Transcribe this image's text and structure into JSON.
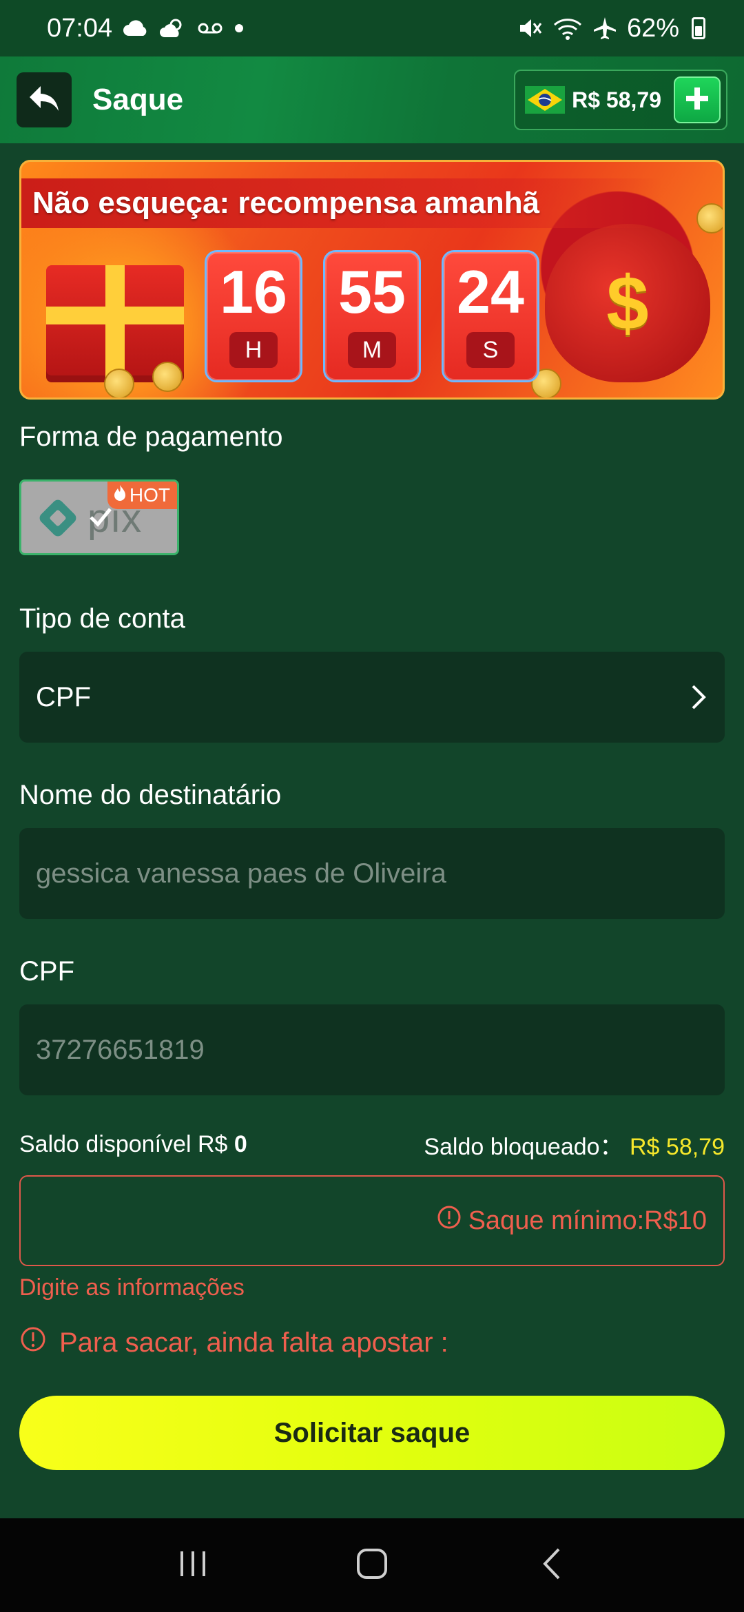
{
  "status_bar": {
    "time": "07:04",
    "battery": "62%",
    "icons": [
      "cloud-icon",
      "partly-cloudy-icon",
      "voicemail-icon",
      "dot-icon",
      "mute-icon",
      "wifi-icon",
      "airplane-icon",
      "battery-icon"
    ]
  },
  "header": {
    "title": "Saque",
    "balance": "R$ 58,79",
    "icons": [
      "back-arrow-icon",
      "brazil-flag-icon",
      "plus-icon"
    ]
  },
  "banner": {
    "title": "Não esqueça: recompensa amanhã",
    "timer": [
      {
        "value": "16",
        "unit": "H"
      },
      {
        "value": "55",
        "unit": "M"
      },
      {
        "value": "24",
        "unit": "S"
      }
    ],
    "bag_symbol": "$"
  },
  "payment": {
    "label": "Forma de pagamento",
    "method_name": "pix",
    "badge": "HOT"
  },
  "account_type": {
    "label": "Tipo de conta",
    "value": "CPF"
  },
  "recipient": {
    "label": "Nome do destinatário",
    "placeholder": "gessica vanessa paes de Oliveira"
  },
  "cpf": {
    "label": "CPF",
    "placeholder": "37276651819"
  },
  "balances": {
    "available_label": "Saldo disponível R$",
    "available_value": "0",
    "blocked_label": "Saldo bloqueado：",
    "blocked_value": "R$ 58,79"
  },
  "amount": {
    "placeholder": "Saque mínimo:R$10",
    "error": "Digite as informações"
  },
  "bet_warning": "Para sacar, ainda falta apostar :",
  "submit_label": "Solicitar saque",
  "colors": {
    "background": "#12452a",
    "header": "#0f7a3a",
    "field": "#0f3220",
    "error": "#ef5f4e",
    "highlight": "#f5e72b",
    "button": "#e3ff0e"
  }
}
